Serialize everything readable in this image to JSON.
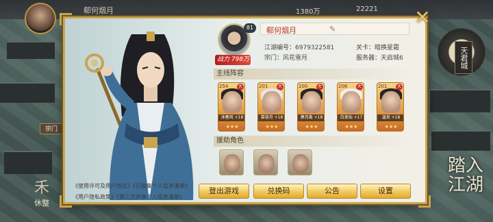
{
  "topbar": {
    "player_name": "郗何烟月",
    "stat_a": "1380万",
    "stat_b": "22221"
  },
  "left_hud": {
    "sect_label": "宗门",
    "rest_char": "禾",
    "rest_label": "休整"
  },
  "right_hud": {
    "city_name": "天君城",
    "brand_text": "踏入江湖"
  },
  "profile": {
    "level": "81",
    "power_label": "战力",
    "power_value": "798万",
    "name": "郗何烟月",
    "id_label": "江湖编号：",
    "id_value": "6979322581",
    "sect_label": "宗门：",
    "sect_value": "风花雪月",
    "stage_label": "关卡：",
    "stage_value": "暗换星霜",
    "server_label": "服务器：",
    "server_value": "天启城6"
  },
  "lineup": {
    "title": "主线阵容",
    "heroes": [
      {
        "level": "254",
        "name": "沐春风",
        "plus": "+18"
      },
      {
        "level": "201",
        "name": "慕容月",
        "plus": "+18"
      },
      {
        "level": "200",
        "name": "萧月离",
        "plus": "+18"
      },
      {
        "level": "206",
        "name": "白发仙",
        "plus": "+17"
      },
      {
        "level": "201",
        "name": "温良",
        "plus": "+18"
      }
    ]
  },
  "assist": {
    "title": "援助角色"
  },
  "footer": {
    "links": [
      "《使用许可及用户协议》",
      "《已收集个人信息清单》",
      "《用户隐私政策》",
      "《第三方共享个人信息清单》"
    ],
    "buttons": [
      "登出游戏",
      "兑换码",
      "公告",
      "设置"
    ]
  },
  "colors": {
    "frame_gold": "#c9a54e",
    "button_gold": "#f2c85c",
    "power_red": "#b01d1d",
    "name_red": "#b23b2b"
  }
}
